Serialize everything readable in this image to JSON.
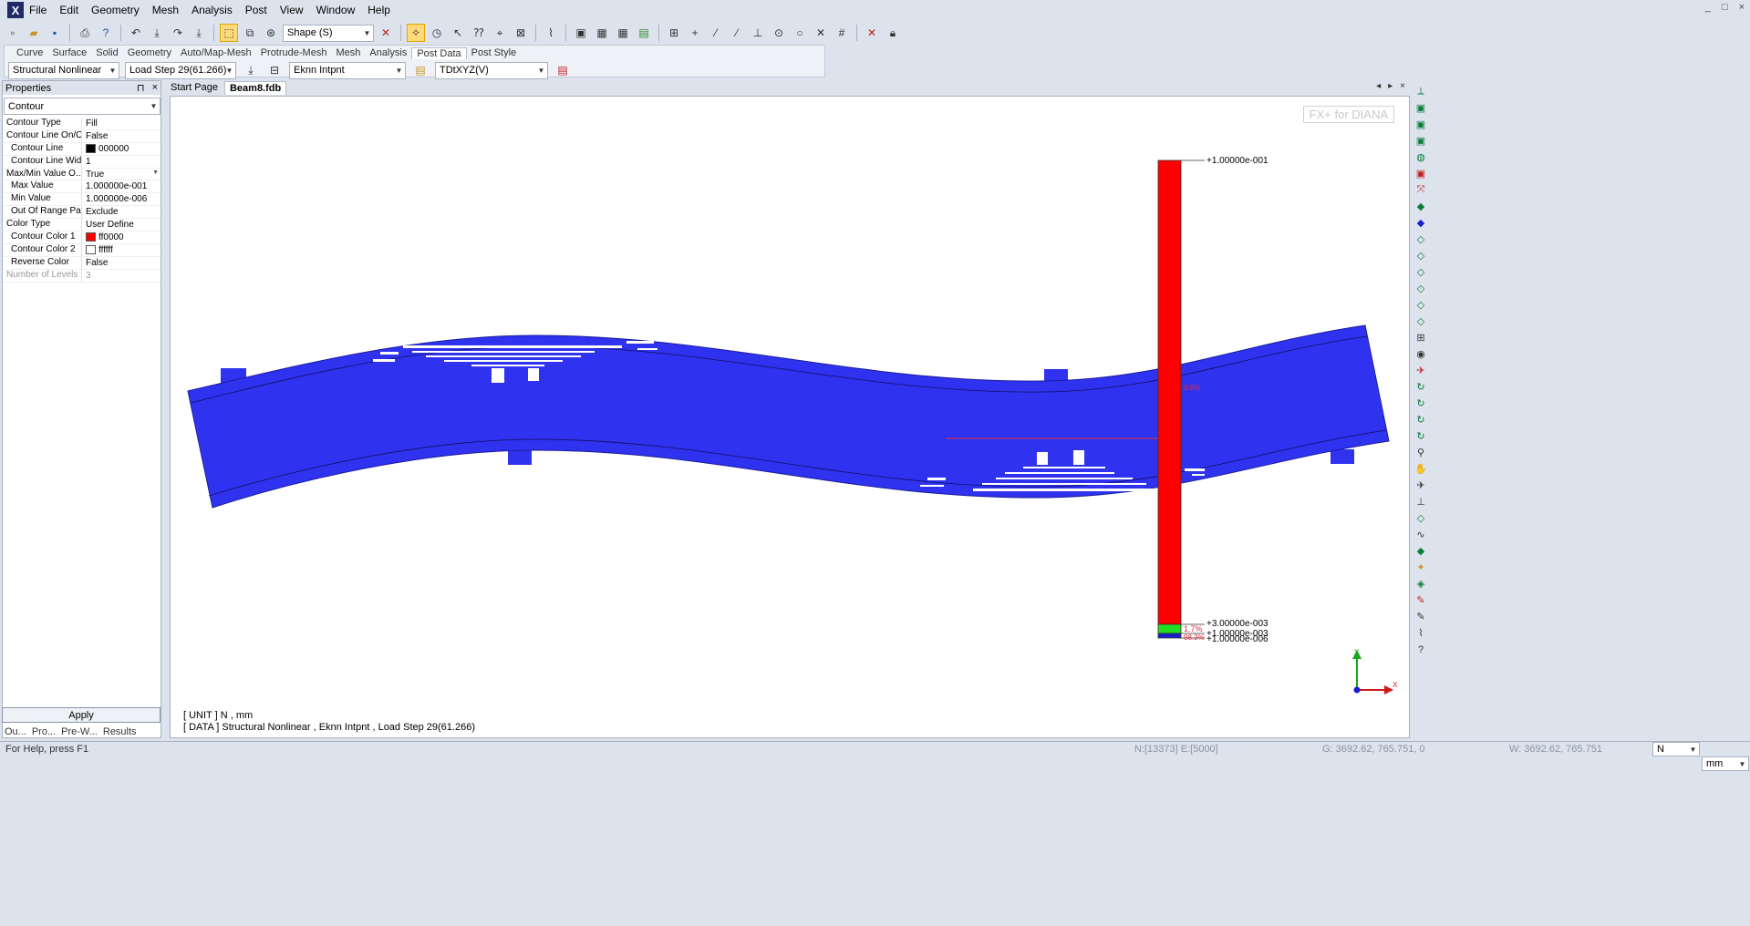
{
  "menu": {
    "logo": "X",
    "items": [
      "File",
      "Edit",
      "Geometry",
      "Mesh",
      "Analysis",
      "Post",
      "View",
      "Window",
      "Help"
    ]
  },
  "window_controls": [
    "_",
    "□",
    "×"
  ],
  "toolbar": {
    "shape_combo": "Shape (S)"
  },
  "ribbon": {
    "tabs": [
      "Curve",
      "Surface",
      "Solid",
      "Geometry",
      "Auto/Map-Mesh",
      "Protrude-Mesh",
      "Mesh",
      "Analysis",
      "Post Data",
      "Post Style"
    ],
    "active_tab": "Post Data",
    "analysis_combo": "Structural Nonlinear",
    "step_combo": "Load Step 29(61.266)",
    "result_combo": "Eknn Intpnt",
    "component_combo": "TDtXYZ(V)"
  },
  "properties": {
    "title": "Properties",
    "pin": "⊓",
    "close": "×",
    "selector": "Contour",
    "rows": [
      {
        "k": "Contour Type",
        "v": "Fill",
        "indent": false
      },
      {
        "k": "Contour Line On/Off",
        "v": "False",
        "indent": false
      },
      {
        "k": "Contour Line",
        "v": "000000",
        "indent": true,
        "swatch": "#000000"
      },
      {
        "k": "Contour Line Width",
        "v": "1",
        "indent": true
      },
      {
        "k": "Max/Min Value O...",
        "v": "True",
        "indent": false,
        "dropdown": true
      },
      {
        "k": "Max Value",
        "v": "1.000000e-001",
        "indent": true
      },
      {
        "k": "Min Value",
        "v": "1.000000e-006",
        "indent": true
      },
      {
        "k": "Out Of Range Part",
        "v": "Exclude",
        "indent": true
      },
      {
        "k": "Color Type",
        "v": "User Define",
        "indent": false
      },
      {
        "k": "Contour Color 1",
        "v": "ff0000",
        "indent": true,
        "swatch": "#ff0000"
      },
      {
        "k": "Contour Color 2",
        "v": "ffffff",
        "indent": true,
        "swatch": "#ffffff"
      },
      {
        "k": "Reverse Color",
        "v": "False",
        "indent": true
      },
      {
        "k": "Number of Levels",
        "v": "3",
        "indent": false,
        "disabled": true
      }
    ],
    "apply": "Apply",
    "bottom_tabs": [
      "Ou...",
      "Pro...",
      "Pre-W...",
      "Results"
    ]
  },
  "doc_tabs": [
    "Start Page",
    "Beam8.fdb"
  ],
  "doc_controls": [
    "◂",
    "▸",
    "×"
  ],
  "viewport": {
    "watermark": "FX+ for DIANA",
    "legend": {
      "top": "+1.00000e-001",
      "mid": "+3.00000e-003",
      "low1": "+1.00000e-003",
      "low2": "+1.00000e-006",
      "pct_green": "1.7%",
      "pct_blue": "98.3%",
      "pct_red": "0.0%"
    },
    "unit_line": "[ UNIT ]  N  ,  mm",
    "data_line": "[ DATA ]  Structural Nonlinear  ,  Eknn Intpnt  ,  Load Step 29(61.266)",
    "axis_y": "Y",
    "axis_x": "X"
  },
  "status": {
    "help": "For Help, press F1",
    "nodes": "N:[13373] E:[5000]",
    "g_coord": "G: 3692.62, 765.751, 0",
    "w_coord": "W: 3692.62, 765.751",
    "force_unit": "N",
    "length_unit": "mm"
  }
}
